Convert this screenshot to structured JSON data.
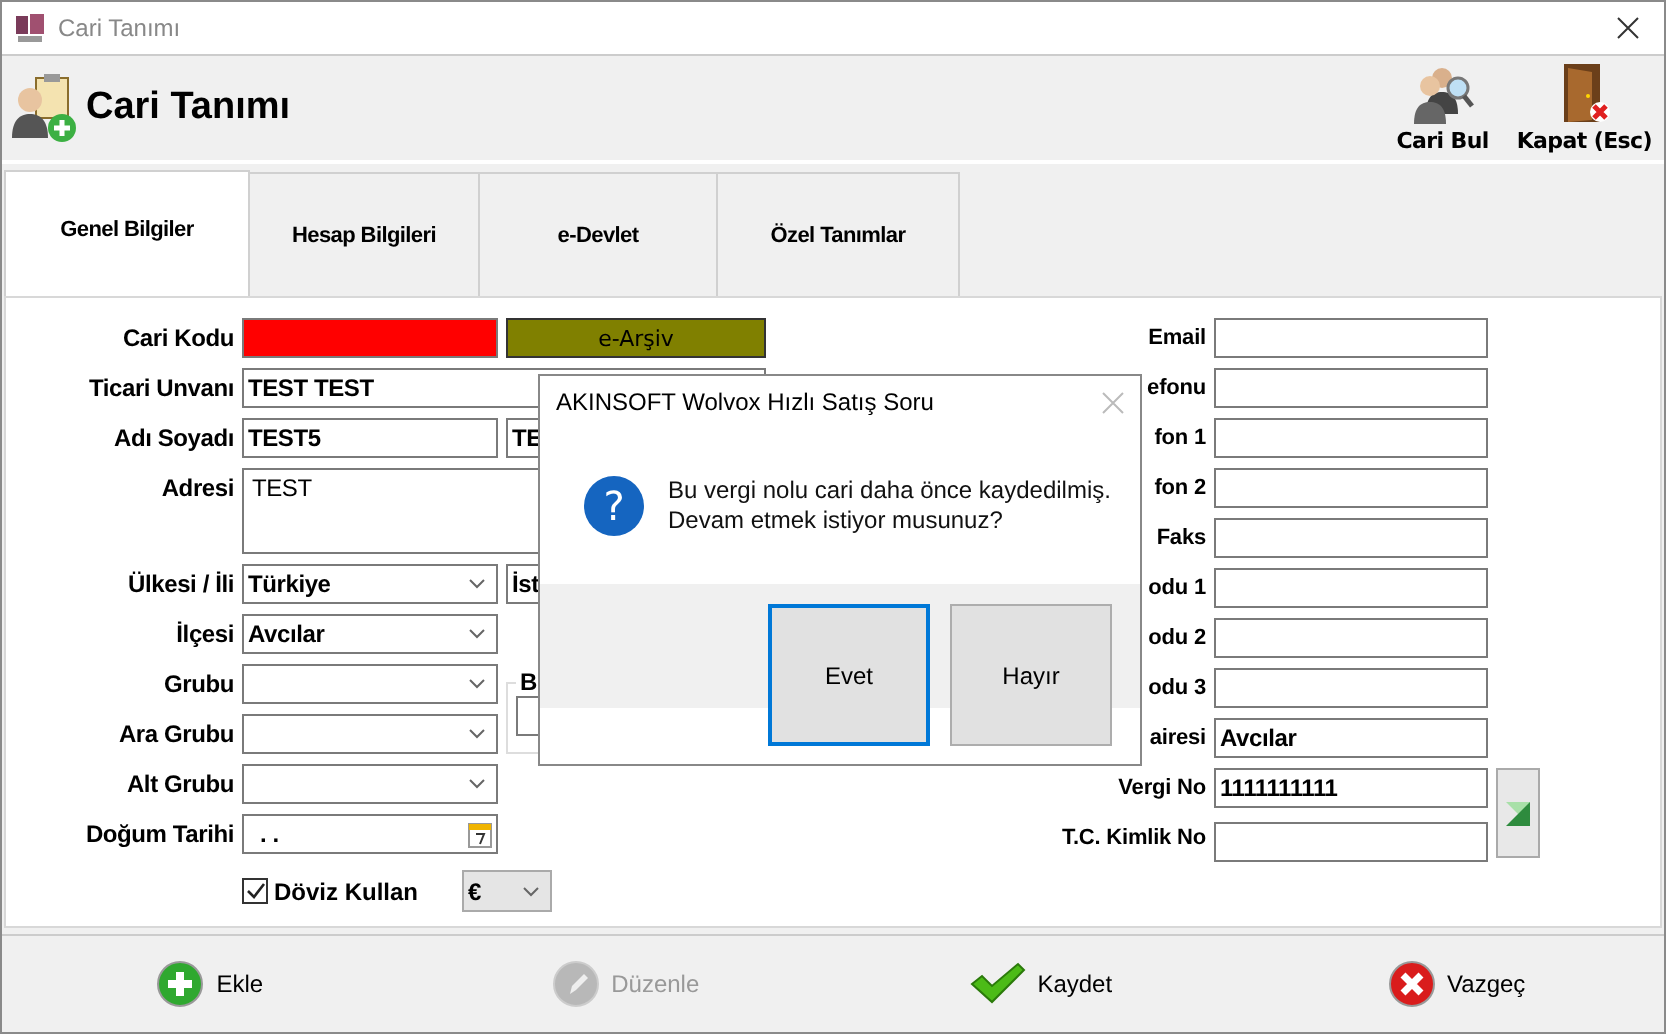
{
  "window": {
    "title": "Cari Tanımı"
  },
  "header": {
    "title": "Cari Tanımı",
    "actions": [
      {
        "kind": "find",
        "label": "Cari Bul"
      },
      {
        "kind": "close",
        "label": "Kapat (Esc)"
      }
    ]
  },
  "tabs": [
    {
      "label": "Genel Bilgiler",
      "selected": true
    },
    {
      "label": "Hesap Bilgileri",
      "selected": false
    },
    {
      "label": "e-Devlet",
      "selected": false
    },
    {
      "label": "Özel Tanımlar",
      "selected": false
    }
  ],
  "left_form": [
    {
      "kind": "code",
      "label": "Cari Kodu",
      "color": "#ff0000",
      "button": "e-Arşiv"
    },
    {
      "kind": "wide",
      "label": "Ticari Unvanı",
      "value": "TEST TEST"
    },
    {
      "kind": "pair",
      "label": "Adı Soyadı",
      "value": "TEST5",
      "value_2": "TE"
    },
    {
      "kind": "textarea",
      "label": "Adresi",
      "value": "TEST"
    },
    {
      "kind": "select_pair",
      "label": "Ülkesi / İli",
      "value": "Türkiye",
      "value_2": "İst"
    },
    {
      "kind": "select",
      "label": "İlçesi",
      "value": "Avcılar"
    },
    {
      "kind": "select_group",
      "label": "Grubu",
      "group": "B"
    },
    {
      "kind": "select",
      "label": "Ara Grubu"
    },
    {
      "kind": "select",
      "label": "Alt Grubu"
    },
    {
      "kind": "date",
      "label": "Doğum Tarihi",
      "value": ". ."
    },
    {
      "kind": "checkbox",
      "caption": "Döviz Kullan",
      "checked": true,
      "currency": "€"
    }
  ],
  "right_form": [
    {
      "label": "Email"
    },
    {
      "label": "efonu"
    },
    {
      "label": "fon 1"
    },
    {
      "label": "fon 2"
    },
    {
      "label": "Faks"
    },
    {
      "label": "odu 1"
    },
    {
      "label": "odu 2"
    },
    {
      "label": "odu 3"
    },
    {
      "label": "airesi",
      "value": "Avcılar"
    },
    {
      "label": "Vergi No",
      "value": "1111111111",
      "kind": "verify"
    },
    {
      "label": "T.C. Kimlik No"
    }
  ],
  "footer": [
    {
      "kind": "add",
      "label": "Ekle",
      "disabled": false
    },
    {
      "kind": "edit",
      "label": "Düzenle",
      "disabled": true
    },
    {
      "kind": "save",
      "label": "Kaydet",
      "disabled": false
    },
    {
      "kind": "cancel",
      "label": "Vazgeç",
      "disabled": false
    }
  ],
  "dialog": {
    "icon": "?",
    "title": "AKINSOFT Wolvox Hızlı Satış Soru",
    "message": "Bu vergi nolu cari daha önce kaydedilmiş.\nDevam etmek istiyor musunuz?",
    "buttons": [
      {
        "label": "Evet",
        "selected": true
      },
      {
        "label": "Hayır",
        "selected": false
      }
    ]
  }
}
